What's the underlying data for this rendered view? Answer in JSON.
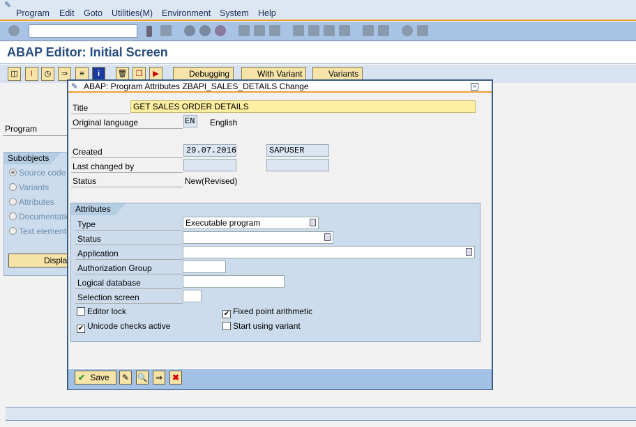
{
  "menu": [
    "Program",
    "Edit",
    "Goto",
    "Utilities(M)",
    "Environment",
    "System",
    "Help"
  ],
  "command_field": {
    "value": ""
  },
  "page_title": "ABAP Editor: Initial Screen",
  "app_toolbar": {
    "debugging": "Debugging",
    "with_variant": "With Variant",
    "variants": "Variants"
  },
  "left": {
    "program_label": "Program",
    "subobjects": "Subobjects",
    "options": [
      "Source code",
      "Variants",
      "Attributes",
      "Documentation",
      "Text elements"
    ],
    "selected": "Source code",
    "display_button": "Display"
  },
  "dialog": {
    "title": "ABAP: Program Attributes ZBAPI_SALES_DETAILS Change",
    "title_label": "Title",
    "title_value": "GET SALES ORDER DETAILS",
    "orig_lang_label": "Original language",
    "orig_lang_code": "EN",
    "orig_lang_name": "English",
    "created_label": "Created",
    "created_date": "29.07.2016",
    "created_user": "SAPUSER",
    "changed_label": "Last changed by",
    "changed_date": "",
    "changed_user": "",
    "status_label": "Status",
    "status_value": "New(Revised)",
    "attributes": {
      "header": "Attributes",
      "type_label": "Type",
      "type_value": "Executable program",
      "status_label": "Status",
      "status_value": "",
      "application_label": "Application",
      "application_value": "",
      "auth_label": "Authorization Group",
      "auth_value": "",
      "ldb_label": "Logical database",
      "ldb_value": "",
      "selscreen_label": "Selection screen",
      "selscreen_value": "",
      "editor_lock": {
        "label": "Editor lock",
        "checked": false
      },
      "unicode": {
        "label": "Unicode checks active",
        "checked": true
      },
      "fixed_point": {
        "label": "Fixed point arithmetic",
        "checked": true
      },
      "start_variant": {
        "label": "Start using variant",
        "checked": false
      }
    },
    "save": "Save"
  },
  "colors": {
    "accent": "#f0a030",
    "title": "#274c80",
    "toolbar": "#a8c3e4"
  }
}
